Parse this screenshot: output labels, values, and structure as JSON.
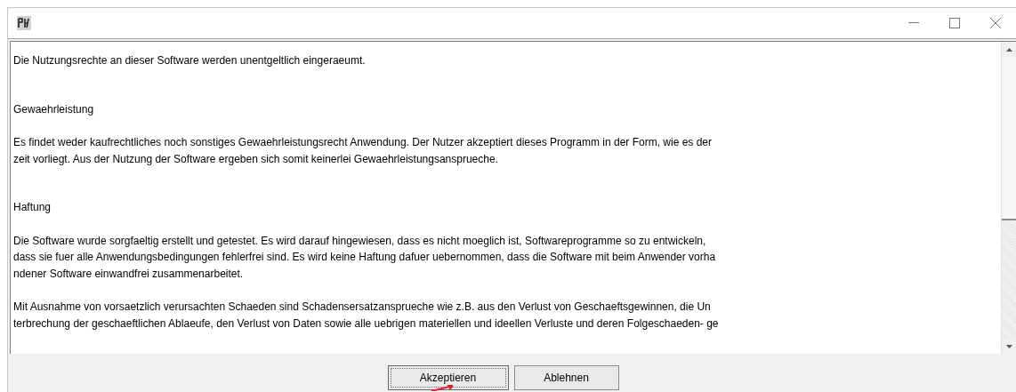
{
  "window": {
    "controls": [
      {
        "kind": "minimize"
      },
      {
        "kind": "maximize"
      },
      {
        "kind": "close"
      }
    ]
  },
  "document": {
    "paragraphs": [
      {
        "kind": "text",
        "lines": [
          "Die Nutzungsrechte an dieser Software werden unentgeltlich eingeraeumt."
        ]
      },
      {
        "kind": "heading",
        "lines": [
          "Gewaehrleistung"
        ]
      },
      {
        "kind": "text",
        "lines": [
          "Es findet weder kaufrechtliches noch sonstiges Gewaehrleistungsrecht Anwendung. Der Nutzer akzeptiert dieses Programm in der Form, wie es der",
          "zeit vorliegt. Aus der Nutzung der Software ergeben sich somit keinerlei Gewaehrleistungsansprueche."
        ]
      },
      {
        "kind": "heading",
        "lines": [
          "Haftung"
        ]
      },
      {
        "kind": "text",
        "lines": [
          "Die Software wurde sorgfaeltig erstellt und getestet. Es wird darauf hingewiesen, dass es nicht moeglich ist, Softwareprogramme so zu entwickeln,",
          "dass sie fuer alle Anwendungsbedingungen fehlerfrei sind. Es wird keine Haftung dafuer uebernommen, dass die Software mit beim Anwender vorha",
          "ndener Software einwandfrei zusammenarbeitet."
        ]
      },
      {
        "kind": "text",
        "lines": [
          "Mit Ausnahme von vorsaetzlich verursachten Schaeden sind Schadensersatzansprueche wie z.B. aus den Verlust von Geschaeftsgewinnen, die Un",
          "terbrechung der geschaeftlichen Ablaeufe, den Verlust von Daten sowie alle uebrigen materiellen und ideellen Verluste und deren Folgeschaeden- ge"
        ]
      }
    ]
  },
  "buttons": [
    {
      "label": "Akzeptieren",
      "selected": true
    },
    {
      "label": "Ablehnen",
      "selected": false
    }
  ]
}
